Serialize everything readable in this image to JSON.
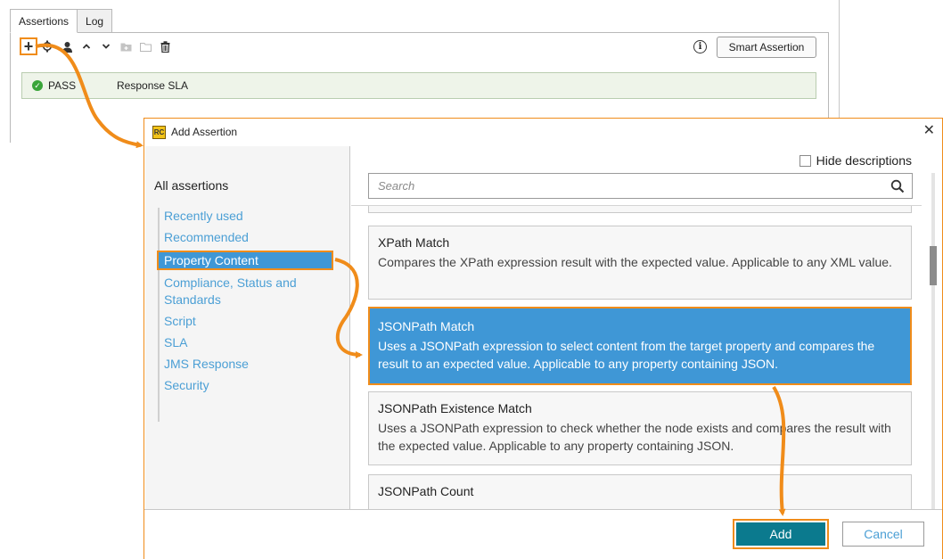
{
  "back_window": {
    "tabs": [
      {
        "label": "Assertions",
        "active": true
      },
      {
        "label": "Log",
        "active": false
      }
    ],
    "toolbar_icons": [
      "plus-icon",
      "gear-icon",
      "user-icon",
      "chevron-up-icon",
      "chevron-down-icon",
      "folder-add-icon",
      "folder-icon",
      "trash-icon"
    ],
    "info_glyph": "i",
    "smart_assertion_label": "Smart Assertion",
    "assertion_row": {
      "status": "PASS",
      "name": "Response SLA",
      "status_color": "#3aa53a"
    }
  },
  "dialog": {
    "title": "Add Assertion",
    "hide_descriptions_label": "Hide descriptions",
    "search_placeholder": "Search",
    "all_assertions_label": "All assertions",
    "categories": [
      {
        "label": "Recently used"
      },
      {
        "label": "Recommended"
      },
      {
        "label": "Property Content",
        "selected": true
      },
      {
        "label": "Compliance, Status and Standards"
      },
      {
        "label": "Script"
      },
      {
        "label": "SLA"
      },
      {
        "label": "JMS Response"
      },
      {
        "label": "Security"
      }
    ],
    "assertions": [
      {
        "name": "XPath Match",
        "description": "Compares the XPath expression result with the expected value. Applicable to any XML value."
      },
      {
        "name": "JSONPath Match",
        "description": "Uses a JSONPath expression to select content from the target property and compares the result to an expected value. Applicable to any property containing JSON.",
        "selected": true
      },
      {
        "name": "JSONPath Existence Match",
        "description": "Uses a JSONPath expression to check whether the node exists and compares the result with the expected value. Applicable to any property containing JSON."
      },
      {
        "name": "JSONPath Count",
        "description": ""
      }
    ],
    "add_label": "Add",
    "cancel_label": "Cancel"
  },
  "colors": {
    "accent_orange": "#f08c1a",
    "selection_blue": "#3f97d6",
    "primary_button": "#0b7a8e",
    "link_blue": "#4b9fd5"
  }
}
